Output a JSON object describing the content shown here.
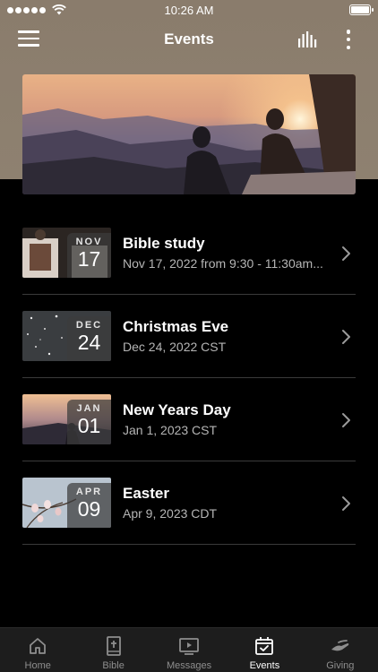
{
  "status_bar": {
    "time": "10:26 AM",
    "signal_dots": 5
  },
  "header": {
    "title": "Events"
  },
  "colors": {
    "top_band": "#8e8170",
    "background": "#000000",
    "tab_bar": "#1d1d1d",
    "active": "#ffffff",
    "inactive": "#8e8e8e"
  },
  "events": [
    {
      "month": "NOV",
      "day": "17",
      "title": "Bible study",
      "subtitle": "Nov 17, 2022 from 9:30 - 11:30am...",
      "thumb": "study"
    },
    {
      "month": "DEC",
      "day": "24",
      "title": "Christmas Eve",
      "subtitle": "Dec 24, 2022 CST",
      "thumb": "stars"
    },
    {
      "month": "JAN",
      "day": "01",
      "title": "New Years Day",
      "subtitle": "Jan 1, 2023 CST",
      "thumb": "sunset"
    },
    {
      "month": "APR",
      "day": "09",
      "title": "Easter",
      "subtitle": "Apr 9, 2023 CDT",
      "thumb": "blossom"
    }
  ],
  "tabs": [
    {
      "label": "Home",
      "icon": "home-icon",
      "active": false
    },
    {
      "label": "Bible",
      "icon": "bible-icon",
      "active": false
    },
    {
      "label": "Messages",
      "icon": "messages-icon",
      "active": false
    },
    {
      "label": "Events",
      "icon": "calendar-icon",
      "active": true
    },
    {
      "label": "Giving",
      "icon": "giving-icon",
      "active": false
    }
  ]
}
